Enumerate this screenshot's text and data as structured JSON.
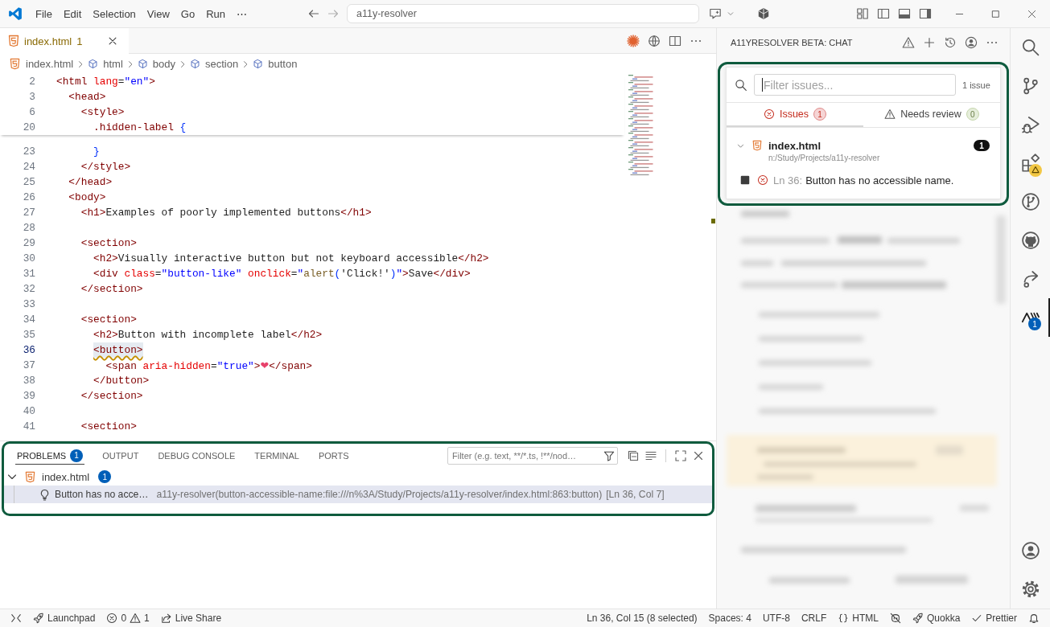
{
  "title_bar": {
    "menu": [
      "File",
      "Edit",
      "Selection",
      "View",
      "Go",
      "Run",
      "⋯"
    ],
    "command_center": "a11y-resolver"
  },
  "editor": {
    "tabs": [
      {
        "label": "index.html",
        "problems": "1",
        "selected": true
      }
    ],
    "breadcrumbs": [
      {
        "label": "index.html",
        "kind": "file"
      },
      {
        "label": "html",
        "kind": "element"
      },
      {
        "label": "body",
        "kind": "element"
      },
      {
        "label": "section",
        "kind": "element"
      },
      {
        "label": "button",
        "kind": "element"
      }
    ],
    "sticky_lines": [
      {
        "number": "2",
        "current": false,
        "squiggle": false,
        "code": [
          {
            "kind": "tag",
            "text": "<html"
          },
          {
            "kind": "attr",
            "text": " lang"
          },
          {
            "kind": "text",
            "text": "="
          },
          {
            "kind": "value",
            "text": "\"en\""
          },
          {
            "kind": "tag",
            "text": ">"
          }
        ]
      },
      {
        "number": "3",
        "current": false,
        "squiggle": false,
        "code": [
          {
            "kind": "tag",
            "text": "  <head>"
          }
        ]
      },
      {
        "number": "6",
        "current": false,
        "squiggle": false,
        "code": [
          {
            "kind": "tag",
            "text": "    <style>"
          }
        ]
      },
      {
        "number": "20",
        "current": false,
        "squiggle": false,
        "code": [
          {
            "kind": "selector",
            "text": "      .hidden-label "
          },
          {
            "kind": "brace",
            "text": "{"
          }
        ]
      }
    ],
    "lines": [
      {
        "number": "23",
        "current": false,
        "squiggle": false,
        "code": [
          {
            "kind": "brace",
            "text": "      }"
          }
        ]
      },
      {
        "number": "24",
        "current": false,
        "squiggle": false,
        "code": [
          {
            "kind": "tag",
            "text": "    </style>"
          }
        ]
      },
      {
        "number": "25",
        "current": false,
        "squiggle": false,
        "code": [
          {
            "kind": "tag",
            "text": "  </head>"
          }
        ]
      },
      {
        "number": "26",
        "current": false,
        "squiggle": false,
        "code": [
          {
            "kind": "tag",
            "text": "  <body>"
          }
        ]
      },
      {
        "number": "27",
        "current": false,
        "squiggle": false,
        "code": [
          {
            "kind": "tag",
            "text": "    <h1>"
          },
          {
            "kind": "text",
            "text": "Examples of poorly implemented buttons"
          },
          {
            "kind": "tag",
            "text": "</h1>"
          }
        ]
      },
      {
        "number": "28",
        "current": false
      },
      {
        "number": "29",
        "current": false,
        "squiggle": false,
        "code": [
          {
            "kind": "tag",
            "text": "    <section>"
          }
        ]
      },
      {
        "number": "30",
        "current": false,
        "squiggle": false,
        "code": [
          {
            "kind": "tag",
            "text": "      <h2>"
          },
          {
            "kind": "text",
            "text": "Visually interactive button but not keyboard accessible"
          },
          {
            "kind": "tag",
            "text": "</h2>"
          }
        ]
      },
      {
        "number": "31",
        "current": false,
        "squiggle": false,
        "code": [
          {
            "kind": "tag",
            "text": "      <div"
          },
          {
            "kind": "attr",
            "text": " class"
          },
          {
            "kind": "text",
            "text": "="
          },
          {
            "kind": "value",
            "text": "\"button-like\""
          },
          {
            "kind": "attr",
            "text": " onclick"
          },
          {
            "kind": "text",
            "text": "="
          },
          {
            "kind": "value",
            "text": "\""
          },
          {
            "kind": "func",
            "text": "alert"
          },
          {
            "kind": "brace",
            "text": "("
          },
          {
            "kind": "text",
            "text": "'Click!'"
          },
          {
            "kind": "brace",
            "text": ")"
          },
          {
            "kind": "value",
            "text": "\""
          },
          {
            "kind": "tag",
            "text": ">"
          },
          {
            "kind": "text",
            "text": "Save"
          },
          {
            "kind": "tag",
            "text": "</div>"
          }
        ]
      },
      {
        "number": "32",
        "current": false,
        "squiggle": false,
        "code": [
          {
            "kind": "tag",
            "text": "    </section>"
          }
        ]
      },
      {
        "number": "33",
        "current": false
      },
      {
        "number": "34",
        "current": false,
        "squiggle": false,
        "code": [
          {
            "kind": "tag",
            "text": "    <section>"
          }
        ]
      },
      {
        "number": "35",
        "current": false,
        "squiggle": false,
        "code": [
          {
            "kind": "tag",
            "text": "      <h2>"
          },
          {
            "kind": "text",
            "text": "Button with incomplete label"
          },
          {
            "kind": "tag",
            "text": "</h2>"
          }
        ]
      },
      {
        "number": "36",
        "current": true,
        "squiggle": true,
        "code": [
          {
            "kind": "tag",
            "text": "      <button>"
          }
        ]
      },
      {
        "number": "37",
        "current": false,
        "squiggle": false,
        "code": [
          {
            "kind": "tag",
            "text": "        <span"
          },
          {
            "kind": "attr",
            "text": " aria-hidden"
          },
          {
            "kind": "text",
            "text": "="
          },
          {
            "kind": "value",
            "text": "\"true\""
          },
          {
            "kind": "tag",
            "text": ">"
          },
          {
            "kind": "emoji",
            "text": "❤"
          },
          {
            "kind": "tag",
            "text": "</span>"
          }
        ]
      },
      {
        "number": "38",
        "current": false,
        "squiggle": false,
        "code": [
          {
            "kind": "tag",
            "text": "      </button>"
          }
        ]
      },
      {
        "number": "39",
        "current": false,
        "squiggle": false,
        "code": [
          {
            "kind": "tag",
            "text": "    </section>"
          }
        ]
      },
      {
        "number": "40",
        "current": false
      },
      {
        "number": "41",
        "current": false,
        "squiggle": false,
        "code": [
          {
            "kind": "tag",
            "text": "    <section>"
          }
        ]
      }
    ]
  },
  "panel": {
    "tabs": [
      {
        "label": "PROBLEMS",
        "badge": "1",
        "selected": true
      },
      {
        "label": "OUTPUT",
        "selected": false
      },
      {
        "label": "DEBUG CONSOLE",
        "selected": false
      },
      {
        "label": "TERMINAL",
        "selected": false
      },
      {
        "label": "PORTS",
        "selected": false
      }
    ],
    "filter": {
      "placeholder": "Filter (e.g. text, **/*.ts, !**/nod…"
    },
    "groups": [
      {
        "file": "index.html",
        "count": "1",
        "expanded": true,
        "problems": [
          {
            "message": "Button has no acce…",
            "source": "a11y-resolver(button-accessible-name:file:///n%3A/Study/Projects/a11y-resolver/index.html:863:button)",
            "location": "[Ln 36, Col 7]",
            "selected": true
          }
        ]
      }
    ]
  },
  "chat": {
    "title": "A11YRESOLVER BETA: CHAT",
    "filter": {
      "placeholder": "Filter issues...",
      "focused": true
    },
    "issue_count": "1 issue",
    "tabs": [
      {
        "label": "Issues",
        "badge": "1",
        "kind": "error",
        "selected": true
      },
      {
        "label": "Needs review",
        "badge": "0",
        "kind": "warning",
        "selected": false
      }
    ],
    "files": [
      {
        "name": "index.html",
        "path": "n:/Study/Projects/a11y-resolver",
        "count": "1",
        "expanded": true,
        "issues": [
          {
            "location": "Ln 36:",
            "message": "Button has no accessible name."
          }
        ]
      }
    ]
  },
  "activity_bar": {
    "items": [
      {
        "kind": "search",
        "selected": false,
        "warning": false
      },
      {
        "kind": "source-control",
        "selected": false,
        "warning": false
      },
      {
        "kind": "run-debug",
        "selected": false,
        "warning": false
      },
      {
        "kind": "extensions",
        "selected": false,
        "warning": true
      },
      {
        "kind": "pull-requests",
        "selected": false,
        "warning": false
      },
      {
        "kind": "github",
        "selected": false,
        "warning": false
      },
      {
        "kind": "live-share",
        "selected": false,
        "warning": false
      },
      {
        "kind": "accessibility",
        "selected": true,
        "warning": false,
        "badge": "1"
      }
    ],
    "bottom": [
      {
        "kind": "account"
      },
      {
        "kind": "settings"
      }
    ]
  },
  "status_bar": {
    "left": [
      {
        "kind": "remote"
      },
      {
        "kind": "launchpad",
        "label": "Launchpad"
      },
      {
        "kind": "problems",
        "errors": "0",
        "warnings": "1"
      },
      {
        "kind": "live-share",
        "label": "Live Share"
      }
    ],
    "right": [
      {
        "kind": "text",
        "label": "Ln 36, Col 15 (8 selected)"
      },
      {
        "kind": "text",
        "label": "Spaces: 4"
      },
      {
        "kind": "text",
        "label": "UTF-8"
      },
      {
        "kind": "text",
        "label": "CRLF"
      },
      {
        "kind": "language",
        "label": "HTML"
      },
      {
        "kind": "copilot"
      },
      {
        "kind": "quokka",
        "label": "Quokka"
      },
      {
        "kind": "prettier",
        "label": "Prettier"
      },
      {
        "kind": "bell"
      }
    ]
  }
}
